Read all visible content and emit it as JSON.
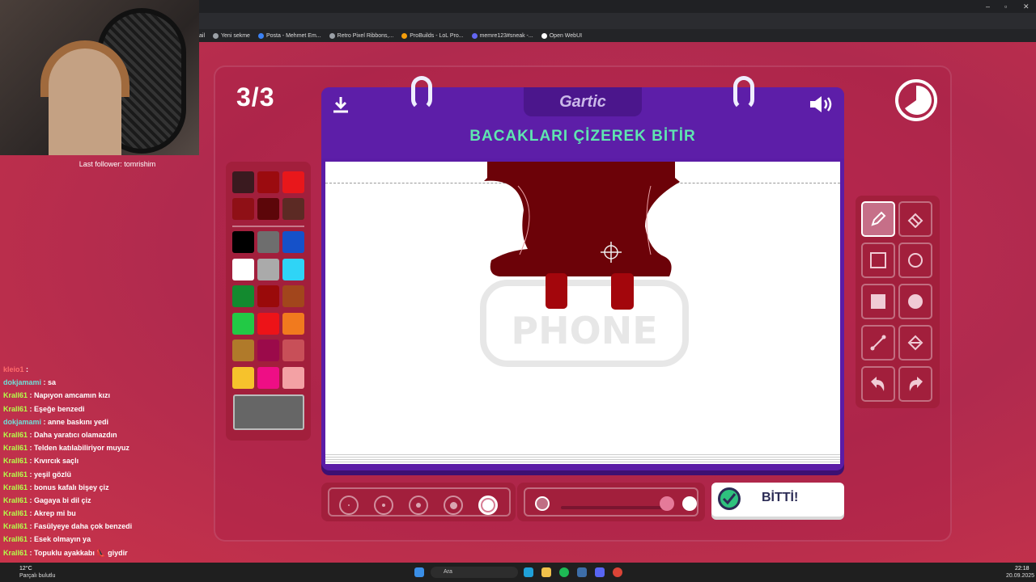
{
  "browser": {
    "bookmarks": [
      "ail",
      "Yeni sekme",
      "Posta - Mehmet Em...",
      "Retro Pixel Ribbons,...",
      "ProBuilds - LoL Pro...",
      "memre123#sneak -...",
      "Open WebUI"
    ],
    "window_controls": [
      "–",
      "▫",
      "✕"
    ]
  },
  "game": {
    "round": "3/3",
    "logo": "Gartic",
    "task": "BACAKLARI ÇİZEREK BİTİR",
    "watermark": "PHONE",
    "done_label": "BİTTİ!",
    "palette_colors": [
      "#3a1a1f",
      "#9b0b0f",
      "#e8171b",
      "#8f1016",
      "#5c0609",
      "#5c2a24",
      "#000000",
      "#6e6e6e",
      "#1551c9",
      "#ffffff",
      "#aaaaaa",
      "#2fd4f6",
      "#138a2f",
      "#9a0a0a",
      "#a2461c",
      "#22c945",
      "#ed1318",
      "#f17a1e",
      "#b07a2a",
      "#9b0a4a",
      "#c84f58",
      "#f6c22c",
      "#ee0e85",
      "#f3a1a4"
    ],
    "selected_color": "#666666",
    "tools": [
      "pencil-icon",
      "eraser-icon",
      "rectangle-outline-icon",
      "circle-outline-icon",
      "rectangle-fill-icon",
      "circle-fill-icon",
      "line-icon",
      "fill-bucket-icon",
      "undo-icon",
      "redo-icon"
    ],
    "selected_tool": "pencil-icon",
    "brush_sizes_selected_index": 4,
    "opacity_level": 1.0
  },
  "stream": {
    "last_follower": "Last follower: tomrishim",
    "chat": [
      {
        "user": "kleio1",
        "text": ""
      },
      {
        "user": "dokjamami",
        "text": "sa"
      },
      {
        "user": "Krall61",
        "text": "Napıyon amcamın kızı"
      },
      {
        "user": "Krall61",
        "text": "Eşeğe benzedi"
      },
      {
        "user": "dokjamami",
        "text": "anne baskını yedi"
      },
      {
        "user": "Krall61",
        "text": "Daha yaratıcı olamazdın"
      },
      {
        "user": "Krall61",
        "text": "Telden katılabiliriyor muyuz"
      },
      {
        "user": "Krall61",
        "text": "Kıvırcık saçlı"
      },
      {
        "user": "Krall61",
        "text": "yeşil gözlü"
      },
      {
        "user": "Krall61",
        "text": "bonus kafalı bişey çiz"
      },
      {
        "user": "Krall61",
        "text": "Gagaya bi dil çiz"
      },
      {
        "user": "Krall61",
        "text": "Akrep mi bu"
      },
      {
        "user": "Krall61",
        "text": "Fasülyeye daha çok benzedi"
      },
      {
        "user": "Krall61",
        "text": "Esek olmayın ya"
      },
      {
        "user": "Krall61",
        "text": "Topuklu ayakkabı 👠 giydir"
      }
    ]
  },
  "taskbar": {
    "weather_temp": "12°C",
    "weather_desc": "Parçalı bulutlu",
    "search_placeholder": "Ara",
    "time": "22:18",
    "date": "20.09.2025"
  }
}
